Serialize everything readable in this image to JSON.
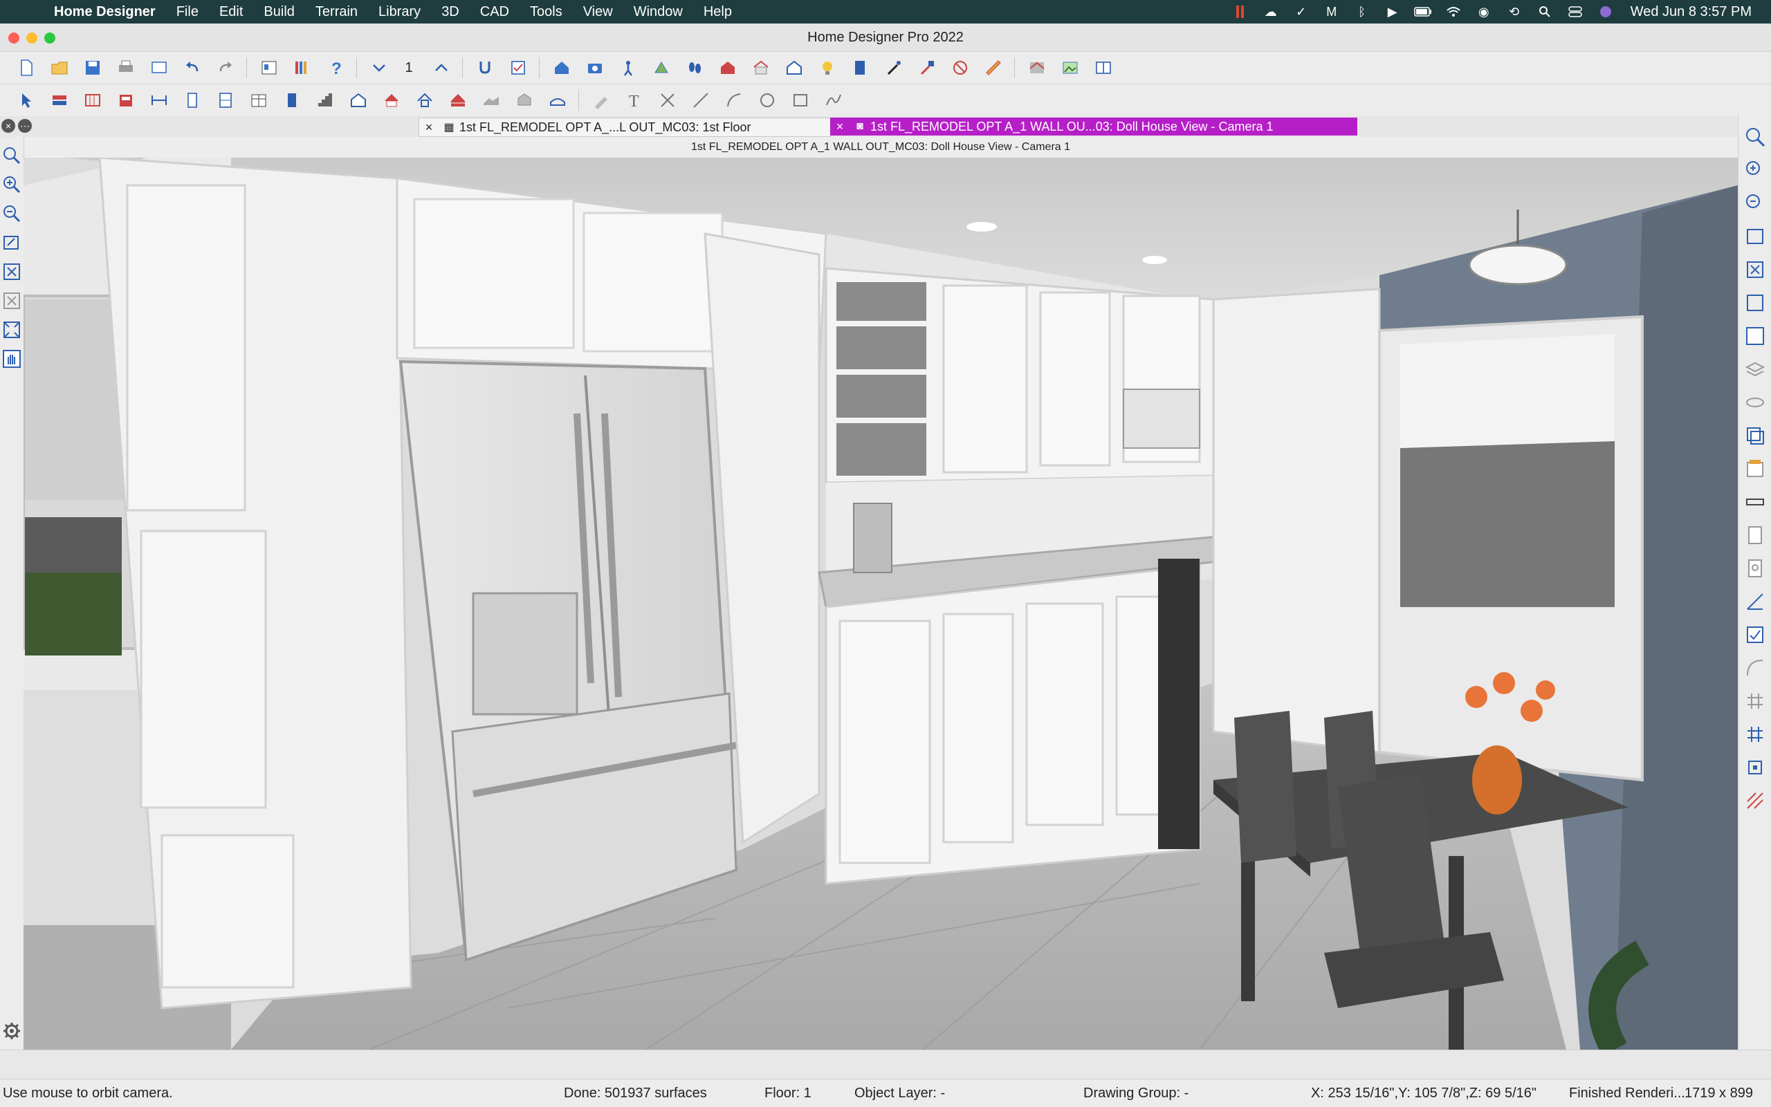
{
  "menubar": {
    "app_name": "Home Designer",
    "items": [
      "File",
      "Edit",
      "Build",
      "Terrain",
      "Library",
      "3D",
      "CAD",
      "Tools",
      "View",
      "Window",
      "Help"
    ],
    "clock": "Wed Jun 8  3:57 PM"
  },
  "window": {
    "title": "Home Designer Pro 2022"
  },
  "toolbar": {
    "floor_value": "1"
  },
  "tabs": [
    {
      "label": "1st FL_REMODEL OPT A_...L OUT_MC03: 1st Floor",
      "active": false
    },
    {
      "label": "1st FL_REMODEL OPT A_1 WALL OU...03: Doll House View - Camera 1",
      "active": true
    }
  ],
  "view": {
    "title": "1st FL_REMODEL OPT A_1 WALL OUT_MC03: Doll House View - Camera 1"
  },
  "colors": {
    "menubar_bg": "#1f3d3f",
    "active_tab": "#b61fc7",
    "wall_blue": "#6f7d8e",
    "cabinet_white": "#f3f3f3",
    "floor_gray": "#b8b8b8"
  },
  "status": {
    "hint": "Use mouse to orbit camera.",
    "done": "Done:  501937 surfaces",
    "floor": "Floor: 1",
    "object_layer": "Object Layer: -",
    "drawing_group": "Drawing Group: -",
    "coords": "X: 253 15/16\",Y: 105 7/8\",Z: 69 5/16\"",
    "render": "Finished Renderi...",
    "size": "1719 x 899"
  }
}
